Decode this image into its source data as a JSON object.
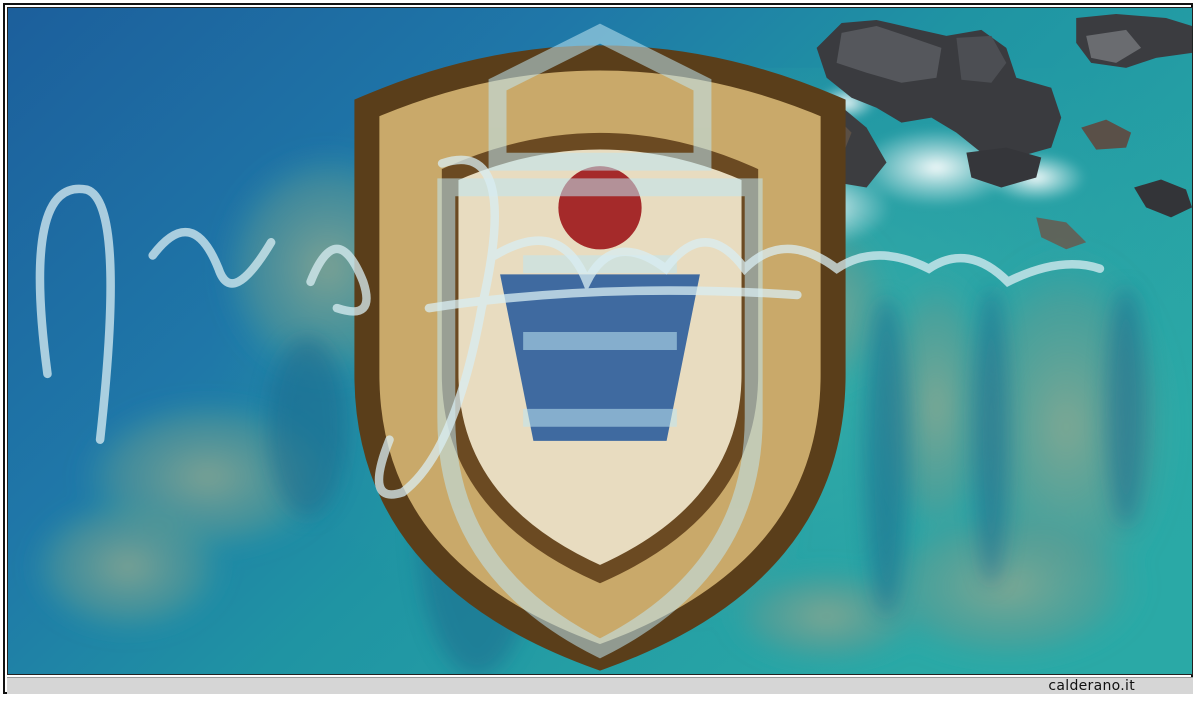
{
  "footer": {
    "site_text": "calderano.it"
  },
  "photo": {
    "content_icons": [
      "coat-of-arms-icon",
      "signature-icon",
      "watermark-emblem-icon"
    ],
    "colors": {
      "deep_sea": "#1f6fa8",
      "shallow_sea": "#2aa3a6",
      "reef": "#7c9a86",
      "rock": "#3a3a3c",
      "foam": "#f2f5f6",
      "caption_bar": "#d6d6d6"
    }
  }
}
